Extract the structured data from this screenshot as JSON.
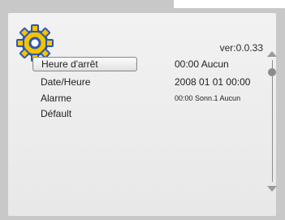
{
  "header": {
    "version": "ver:0.0.33"
  },
  "menu": {
    "items": [
      {
        "label": "Heure d'arrêt",
        "value": "00:00    Aucun",
        "selected": true
      },
      {
        "label": "Date/Heure",
        "value": "2008 01 01 00:00"
      },
      {
        "label": "Alarme",
        "value": "00:00 Sonn.1 Aucun"
      },
      {
        "label": "Défault",
        "value": ""
      }
    ]
  },
  "icons": {
    "settings": "gear-icon"
  },
  "colors": {
    "panel": "#eeeeee",
    "frame": "#c8c8c8",
    "gear_fill": "#f3c400",
    "gear_ring": "#2f56b0"
  }
}
